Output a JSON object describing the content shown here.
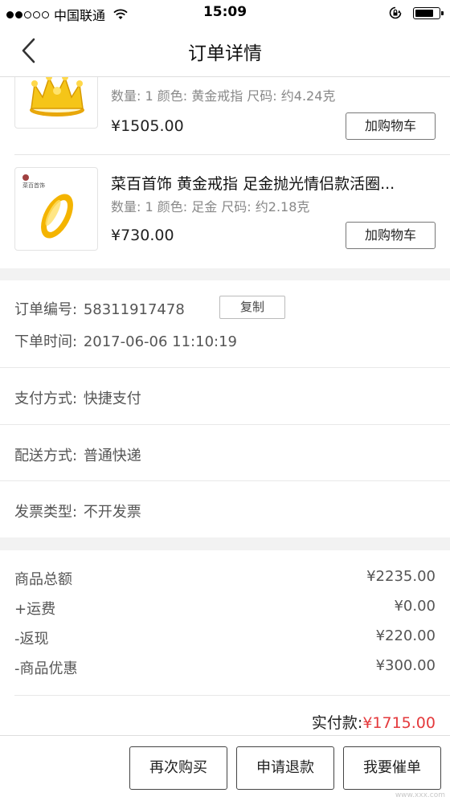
{
  "status_bar": {
    "carrier": "中国联通",
    "time": "15:09",
    "icons": [
      "signal-dots-icon",
      "wifi-icon",
      "rotation-lock-icon",
      "battery-icon"
    ],
    "battery_level": 0.8
  },
  "nav": {
    "title": "订单详情",
    "back_icon": "chevron-left-icon"
  },
  "products": [
    {
      "name": "",
      "meta": "数量: 1 颜色: 黄金戒指 尺码: 约4.24克",
      "price": "¥1505.00",
      "cart_label": "加购物车",
      "image": "gold-crown-ring-image"
    },
    {
      "name": "菜百首饰 黄金戒指 足金抛光情侣款活圈...",
      "meta": "数量: 1 颜色: 足金 尺码: 约2.18克",
      "price": "¥730.00",
      "cart_label": "加购物车",
      "image": "gold-band-ring-image",
      "brand_text": "菜百首饰"
    }
  ],
  "order_info": {
    "order_no_label": "订单编号:",
    "order_no": "58311917478",
    "copy_label": "复制",
    "time_label": "下单时间:",
    "time": "2017-06-06 11:10:19",
    "payment_label": "支付方式:",
    "payment": "快捷支付",
    "shipping_label": "配送方式:",
    "shipping": "普通快递",
    "invoice_label": "发票类型:",
    "invoice": "不开发票"
  },
  "totals": {
    "rows": [
      {
        "label": "商品总额",
        "value": "¥2235.00"
      },
      {
        "label": "+运费",
        "value": "¥0.00"
      },
      {
        "label": "-返现",
        "value": "¥220.00"
      },
      {
        "label": "-商品优惠",
        "value": "¥300.00"
      }
    ],
    "paid_label": "实付款:",
    "paid_value": "¥1715.00",
    "paid_color": "#e4393c"
  },
  "actions": {
    "rebuy": "再次购买",
    "refund": "申请退款",
    "remind": "我要催单"
  },
  "watermark": "www.xxx.com"
}
